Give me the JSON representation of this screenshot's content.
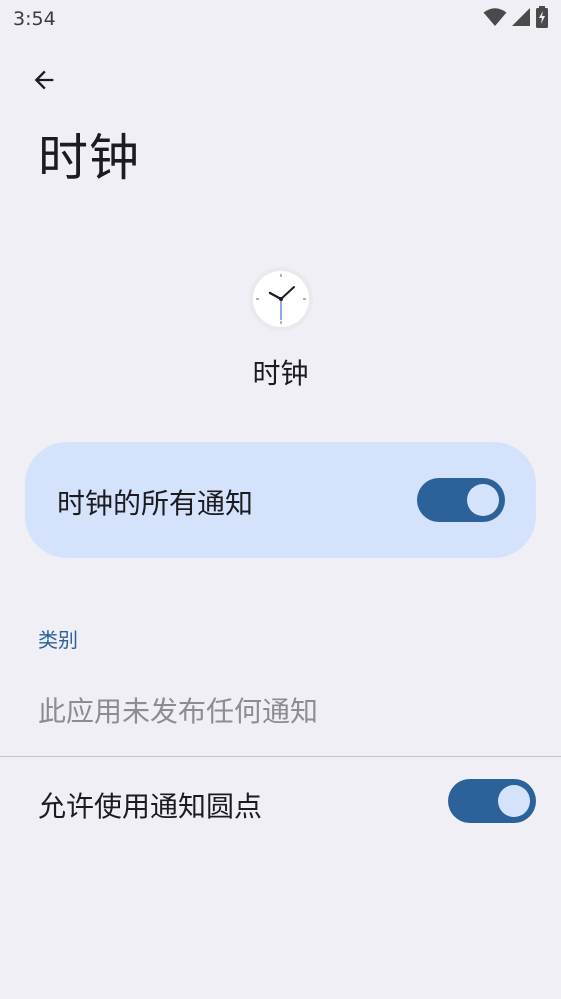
{
  "status_bar": {
    "time": "3:54",
    "icons": [
      "wifi-icon",
      "cellular-signal-icon",
      "battery-charging-icon"
    ]
  },
  "header": {
    "back_icon": "arrow-back-icon",
    "title": "时钟"
  },
  "app": {
    "icon": "clock-app-icon",
    "name": "时钟"
  },
  "all_notifications": {
    "label": "时钟的所有通知",
    "enabled": true
  },
  "categories": {
    "header": "类别",
    "empty_text": "此应用未发布任何通知"
  },
  "notification_dots": {
    "label": "允许使用通知圆点",
    "enabled": true
  },
  "colors": {
    "background": "#f0eff5",
    "card": "#d4e3fb",
    "accent": "#2c6299",
    "disabled_text": "#8d8c92"
  }
}
